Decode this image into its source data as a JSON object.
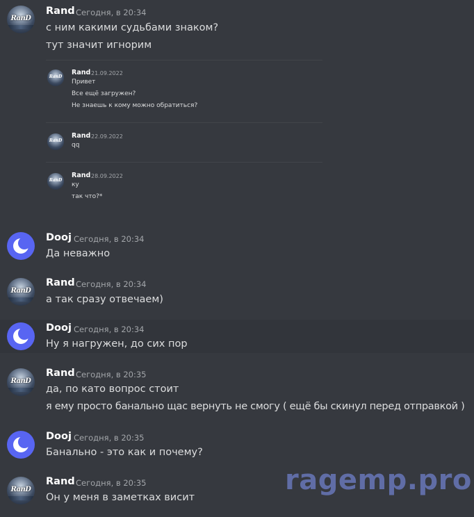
{
  "colors": {
    "background": "#36393f",
    "hover_row": "#32353b",
    "username": "#ffffff",
    "timestamp": "#a3a6aa",
    "message_text": "#dcddde",
    "dooj_avatar": "#5865f2",
    "watermark": "#6f7fc9"
  },
  "avatars": {
    "rand_logo_text": "RanD",
    "dooj_icon": "discord-moon-icon"
  },
  "messages": [
    {
      "author": "Rand",
      "time": "Сегодня, в 20:34",
      "lines": [
        "с ним какими судьбами знаком?",
        "тут значит игнорим"
      ]
    },
    {
      "author": "Dooj",
      "time": "Сегодня, в 20:34",
      "lines": [
        "Да неважно"
      ]
    },
    {
      "author": "Rand",
      "time": "Сегодня, в 20:34",
      "lines": [
        "а так сразу отвечаем)"
      ]
    },
    {
      "author": "Dooj",
      "time": "Сегодня, в 20:34",
      "lines": [
        "Ну я нагружен, до сих пор"
      ]
    },
    {
      "author": "Rand",
      "time": "Сегодня, в 20:35",
      "lines": [
        "да, по като вопрос стоит",
        "я ему просто банально щас вернуть не смогу ( ещё бы скинул перед отправкой )"
      ]
    },
    {
      "author": "Dooj",
      "time": "Сегодня, в 20:35",
      "lines": [
        "Банально - это как и почему?"
      ]
    },
    {
      "author": "Rand",
      "time": "Сегодня, в 20:35",
      "lines": [
        "Он у меня в заметках висит"
      ]
    }
  ],
  "embedded": [
    {
      "author": "Rand",
      "date": "21.09.2022",
      "lines": [
        "Привет",
        "Все ещё загружен?",
        "Не знаешь к кому можно обратиться?"
      ]
    },
    {
      "author": "Rand",
      "date": "22.09.2022",
      "lines": [
        "qq"
      ]
    },
    {
      "author": "Rand",
      "date": "28.09.2022",
      "lines": [
        "ку",
        "так что?*"
      ]
    }
  ],
  "watermark": "ragemp.pro"
}
